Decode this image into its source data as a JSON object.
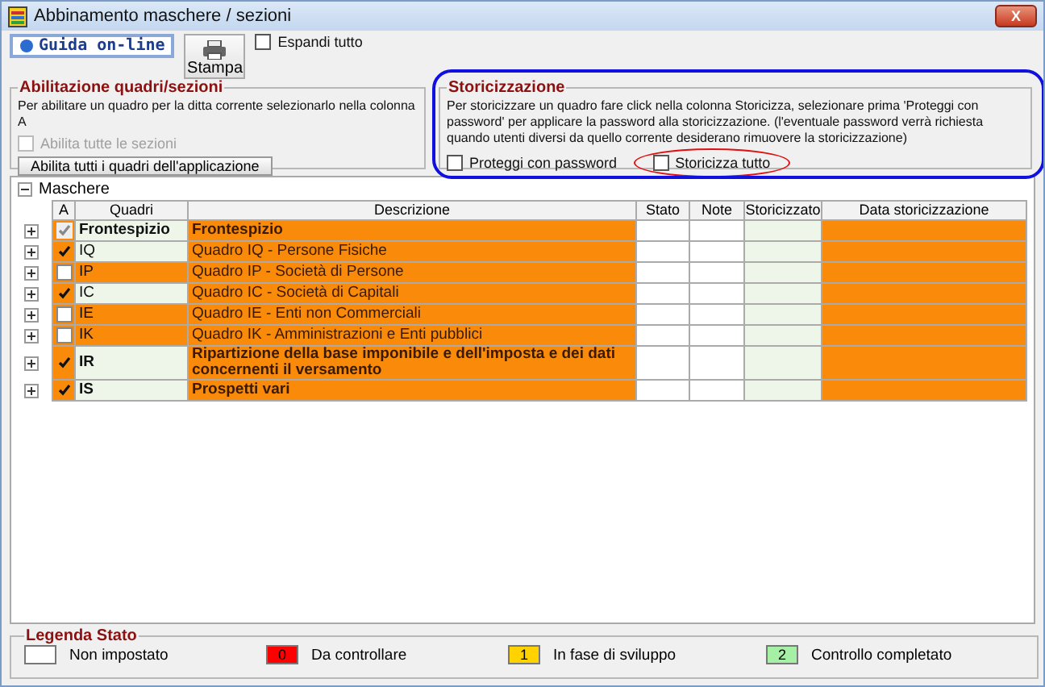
{
  "window": {
    "title": "Abbinamento maschere / sezioni",
    "close": "X"
  },
  "toolbar": {
    "help_button": "Guida on-line",
    "print_button": "Stampa",
    "expand_all": {
      "label": "Espandi tutto",
      "checked": false
    }
  },
  "enable_group": {
    "title": "Abilitazione quadri/sezioni",
    "text": "Per abilitare un quadro per la ditta corrente selezionarlo nella colonna A",
    "enable_sections": {
      "label": "Abilita tutte le sezioni",
      "checked": false,
      "disabled": true
    },
    "button": "Abilita tutti i quadri dell'applicazione"
  },
  "history_group": {
    "title": "Storicizzazione",
    "text": "Per storicizzare un quadro fare click nella colonna Storicizza, selezionare prima 'Proteggi con password' per applicare la password alla storicizzazione. (l'eventuale password verrà richiesta quando utenti diversi da quello corrente desiderano rimuovere la storicizzazione)",
    "protect": {
      "label": "Proteggi con password",
      "checked": false
    },
    "history_all": {
      "label": "Storicizza tutto",
      "checked": false
    }
  },
  "tree": {
    "root": "Maschere",
    "expanded": true,
    "columns": [
      "A",
      "Quadri",
      "Descrizione",
      "Stato",
      "Note",
      "Storicizzato",
      "Data storicizzazione"
    ],
    "rows": [
      {
        "quadro": "Frontespizio",
        "description": "Frontespizio",
        "checked": true,
        "disabled": true,
        "bold": true
      },
      {
        "quadro": "IQ",
        "description": "Quadro IQ - Persone Fisiche",
        "checked": true,
        "disabled": false,
        "bold": false
      },
      {
        "quadro": "IP",
        "description": "Quadro IP - Società di Persone",
        "checked": false,
        "disabled": false,
        "bold": false
      },
      {
        "quadro": "IC",
        "description": "Quadro IC - Società di Capitali",
        "checked": true,
        "disabled": false,
        "bold": false
      },
      {
        "quadro": "IE",
        "description": "Quadro IE - Enti non Commerciali",
        "checked": false,
        "disabled": false,
        "bold": false
      },
      {
        "quadro": "IK",
        "description": "Quadro IK - Amministrazioni e Enti pubblici",
        "checked": false,
        "disabled": false,
        "bold": false
      },
      {
        "quadro": "IR",
        "description": "Ripartizione della base imponibile e dell'imposta e dei dati concernenti il versamento",
        "checked": true,
        "disabled": false,
        "bold": true
      },
      {
        "quadro": "IS",
        "description": "Prospetti vari",
        "checked": true,
        "disabled": false,
        "bold": true
      }
    ]
  },
  "legend": {
    "title": "Legenda Stato",
    "items": [
      {
        "label": "Non impostato",
        "color": "#ffffff"
      },
      {
        "code": "0",
        "label": "Da controllare",
        "color": "#ff0000"
      },
      {
        "code": "1",
        "label": "In fase di sviluppo",
        "color": "#ffd200"
      },
      {
        "code": "2",
        "label": "Controllo completato",
        "color": "#a6f0a6"
      }
    ]
  }
}
